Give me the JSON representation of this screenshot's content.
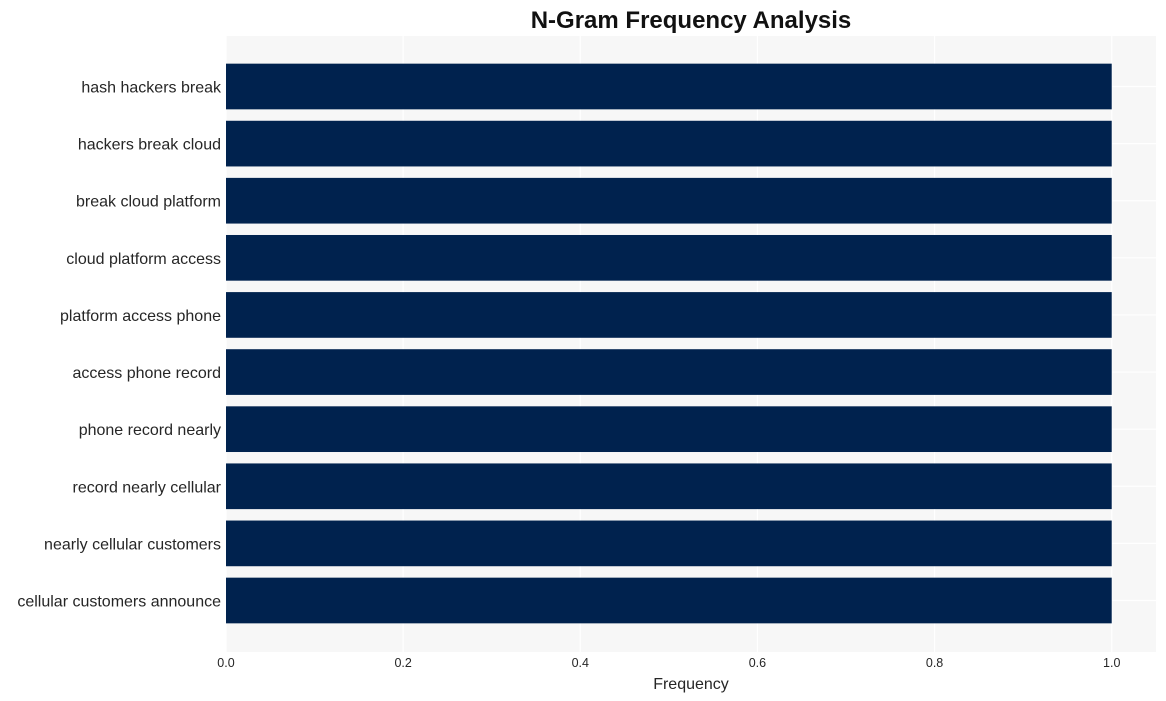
{
  "chart_data": {
    "type": "bar",
    "orientation": "horizontal",
    "title": "N-Gram Frequency Analysis",
    "xlabel": "Frequency",
    "ylabel": "",
    "categories": [
      "hash hackers break",
      "hackers break cloud",
      "break cloud platform",
      "cloud platform access",
      "platform access phone",
      "access phone record",
      "phone record nearly",
      "record nearly cellular",
      "nearly cellular customers",
      "cellular customers announce"
    ],
    "values": [
      1,
      1,
      1,
      1,
      1,
      1,
      1,
      1,
      1,
      1
    ],
    "xlim": [
      0,
      1.05
    ],
    "xticks": [
      0.0,
      0.2,
      0.4,
      0.6,
      0.8,
      1.0
    ],
    "xtick_labels": [
      "0.0",
      "0.2",
      "0.4",
      "0.6",
      "0.8",
      "1.0"
    ],
    "grid": true,
    "legend": "none",
    "colors": {
      "bar": "#00224e",
      "plot_background": "#f7f7f7",
      "grid": "#ffffff"
    }
  }
}
